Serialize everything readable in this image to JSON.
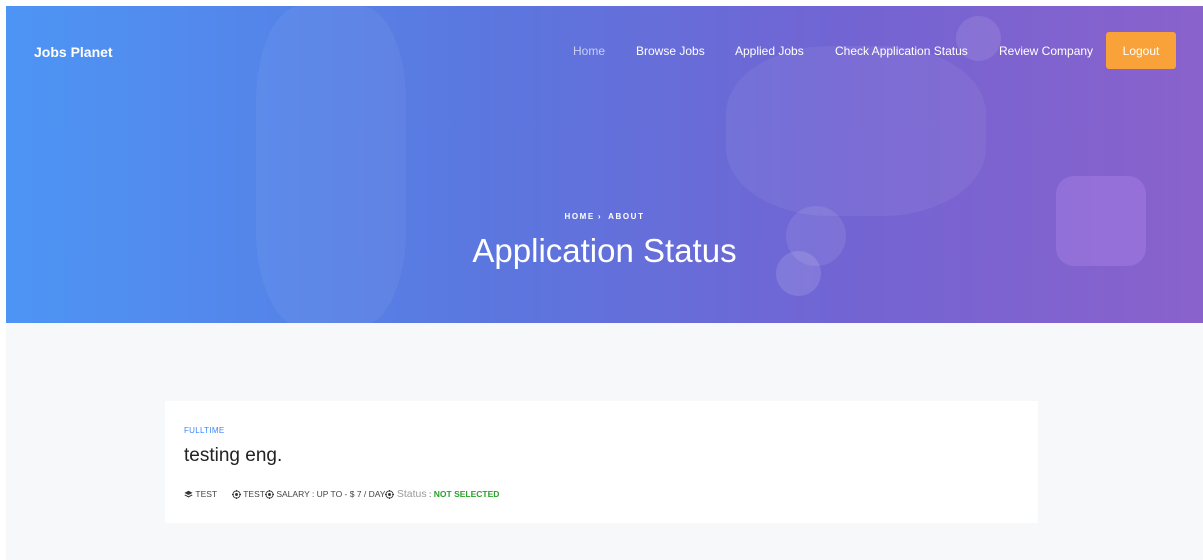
{
  "header": {
    "brand": "Jobs Planet",
    "nav": [
      {
        "label": "Home",
        "active": true
      },
      {
        "label": "Browse Jobs",
        "active": false
      },
      {
        "label": "Applied Jobs",
        "active": false
      },
      {
        "label": "Check Application Status",
        "active": false
      },
      {
        "label": "Review Company",
        "active": false
      }
    ],
    "logout_label": "Logout",
    "logout_color": "#f9a23a"
  },
  "hero": {
    "breadcrumb": {
      "home": "HOME",
      "separator": "›",
      "current": "ABOUT"
    },
    "title": "Application Status"
  },
  "job": {
    "type": "FULLTIME",
    "title": "testing eng.",
    "company_icon": "layers-icon",
    "company": "TEST",
    "location_icon": "target-icon",
    "location": "TEST",
    "salary_icon": "target-icon",
    "salary": "SALARY : UP TO - $ 7 / DAY",
    "status_icon": "target-icon",
    "status_label": "Status",
    "status_separator": ":",
    "status_value": "NOT SELECTED",
    "status_color": "#2ca02c"
  }
}
